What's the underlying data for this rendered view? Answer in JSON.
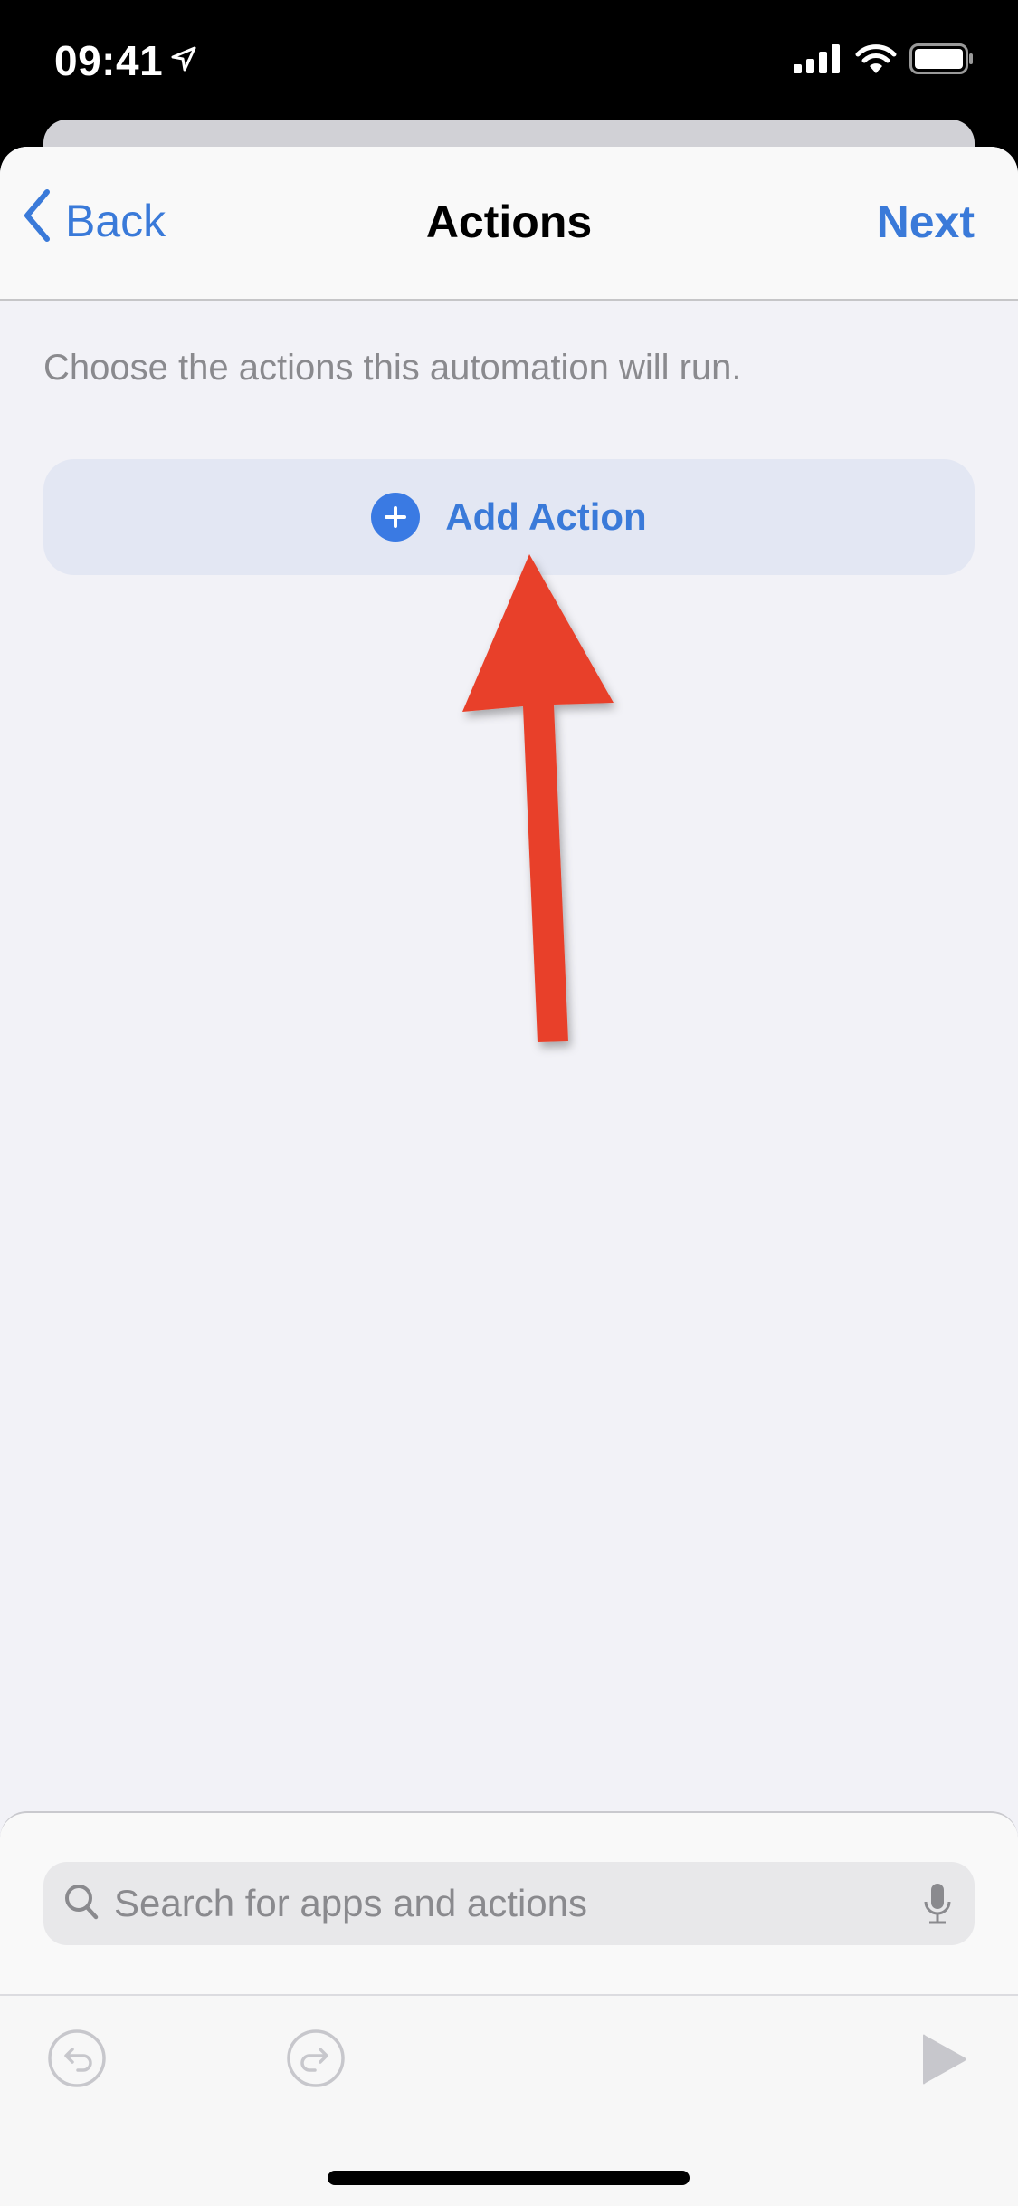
{
  "status_bar": {
    "time": "09:41",
    "location_icon": "location-arrow-icon",
    "signal_icon": "cellular-signal-icon",
    "wifi_icon": "wifi-icon",
    "battery_icon": "battery-icon"
  },
  "nav": {
    "back_label": "Back",
    "title": "Actions",
    "next_label": "Next"
  },
  "content": {
    "hint": "Choose the actions this automation will run.",
    "add_action_label": "Add Action"
  },
  "annotation": {
    "type": "arrow",
    "color": "#e8412a",
    "points_to": "Add Action"
  },
  "search": {
    "placeholder": "Search for apps and actions",
    "value": ""
  },
  "toolbar": {
    "undo_icon": "undo-icon",
    "redo_icon": "redo-icon",
    "play_icon": "play-icon"
  },
  "colors": {
    "accent": "#3a7ad9",
    "background": "#f2f2f7",
    "add_button_bg": "#e3e7f3",
    "arrow": "#e8412a"
  }
}
